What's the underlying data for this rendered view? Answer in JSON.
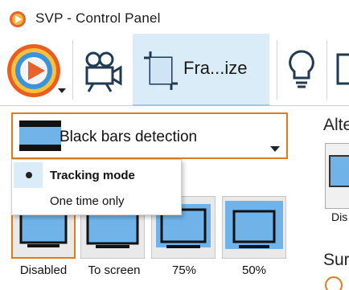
{
  "window": {
    "title": "SVP - Control Panel"
  },
  "toolbar": {
    "buttons": [
      {
        "icon": "svp-logo-icon",
        "label": ""
      },
      {
        "icon": "video-camera-icon",
        "label": ""
      },
      {
        "icon": "crop-frame-icon",
        "label": "Fra...ize"
      },
      {
        "icon": "lightbulb-icon",
        "label": ""
      }
    ],
    "active_index": 2
  },
  "frame_panel": {
    "mode_select": {
      "value": "Black bars detection",
      "options": [
        {
          "label": "Tracking mode",
          "selected": true
        },
        {
          "label": "One time only",
          "selected": false
        }
      ]
    },
    "tiles": [
      {
        "label": "Disabled",
        "selected": true
      },
      {
        "label": "To screen",
        "selected": false
      },
      {
        "label": "75%",
        "selected": false
      },
      {
        "label": "50%",
        "selected": false
      }
    ],
    "right_column": {
      "heading": "Alte",
      "tile_label": "Dis",
      "heading2": "Sur"
    }
  },
  "colors": {
    "accent": "#e07b1a",
    "active_tab": "#d9ecf7",
    "screen_blue": "#6fb3e8"
  }
}
